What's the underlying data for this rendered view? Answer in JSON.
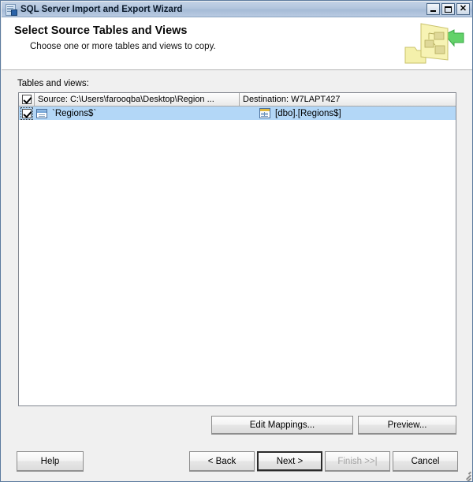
{
  "window": {
    "title": "SQL Server Import and Export Wizard",
    "icon": "wizard-document-icon",
    "controls": {
      "minimize": "_",
      "maximize": "□",
      "close": "✕"
    }
  },
  "header": {
    "heading": "Select Source Tables and Views",
    "subheading": "Choose one or more tables and views to copy.",
    "art_icon": "tables-and-views-art-icon"
  },
  "main": {
    "list_label": "Tables and views:",
    "grid": {
      "columns": {
        "checkbox_header_checked": true,
        "source": "Source: C:\\Users\\farooqba\\Desktop\\Region ...",
        "destination": "Destination: W7LAPT427"
      },
      "rows": [
        {
          "checked": true,
          "source_icon": "worksheet-icon",
          "source": "`Regions$`",
          "destination_icon": "database-table-icon",
          "destination": "[dbo].[Regions$]",
          "selected": true
        }
      ]
    },
    "buttons": {
      "edit_mappings": "Edit Mappings...",
      "edit_mappings_accel": "M",
      "preview": "Preview..."
    }
  },
  "footer": {
    "help": "Help",
    "back": "< Back",
    "next": "Next >",
    "finish": "Finish >>|",
    "cancel": "Cancel",
    "finish_disabled": true,
    "next_is_default": true,
    "resize_grip": "resize-grip-icon"
  },
  "colors": {
    "titlebar": "#b2c5dd",
    "selection": "#b3d7f7",
    "dialog_face": "#f0f0f0",
    "header_band": "#ffffff",
    "grid_border": "#828790",
    "disabled_text": "#a3a3a3"
  }
}
